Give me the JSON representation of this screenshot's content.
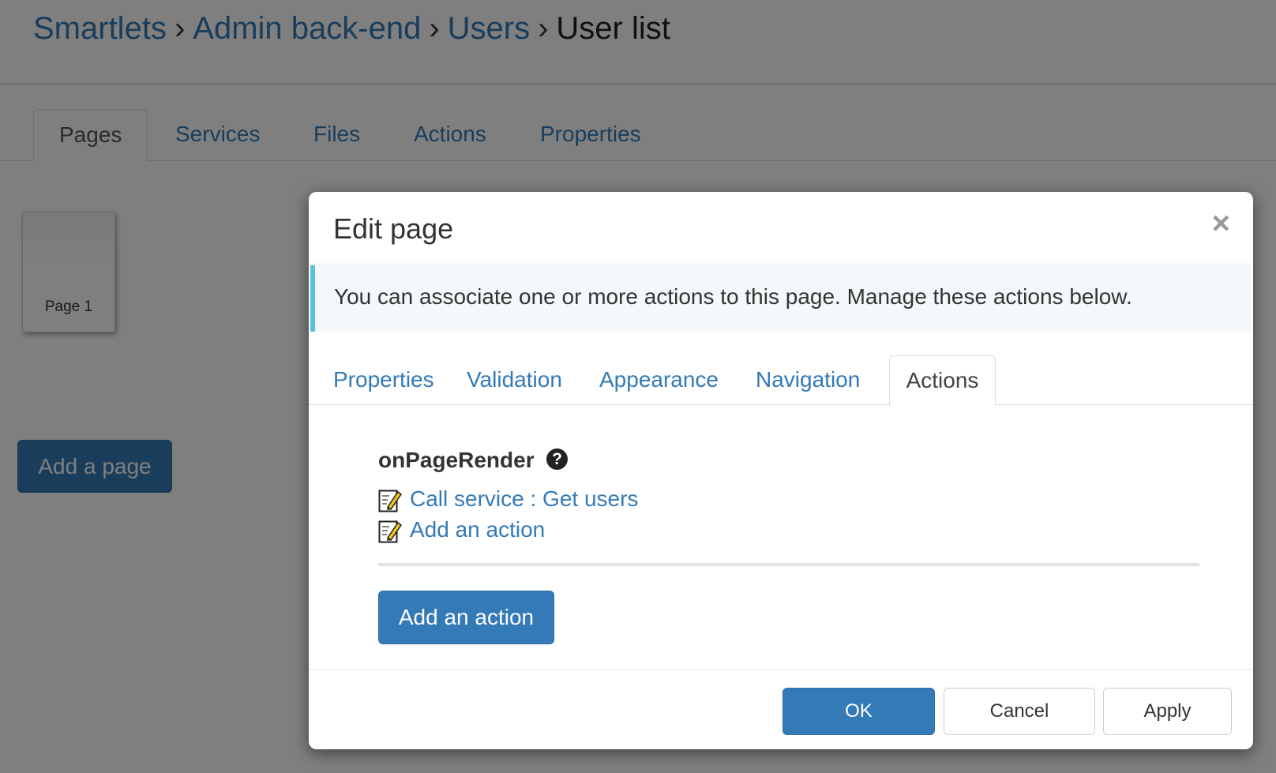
{
  "breadcrumb": {
    "items": [
      "Smartlets",
      "Admin back-end",
      "Users"
    ],
    "current": "User list",
    "separator": "›"
  },
  "main_tabs": [
    "Pages",
    "Services",
    "Files",
    "Actions",
    "Properties"
  ],
  "main_tabs_active": "Pages",
  "page_thumb": {
    "label": "Page 1"
  },
  "add_page_button": "Add a page",
  "modal": {
    "title": "Edit page",
    "close_icon": "×",
    "info": "You can associate one or more actions to this page. Manage these actions below.",
    "tabs": [
      "Properties",
      "Validation",
      "Appearance",
      "Navigation",
      "Actions"
    ],
    "active_tab": "Actions",
    "event": {
      "name": "onPageRender",
      "help_icon": "?",
      "actions": [
        "Call service : Get users",
        "Add an action"
      ]
    },
    "add_action_button": "Add an action",
    "footer": {
      "ok": "OK",
      "cancel": "Cancel",
      "apply": "Apply"
    }
  },
  "colors": {
    "link": "#337ab7",
    "primary": "#337ab7",
    "info_border": "#5bc0de"
  }
}
